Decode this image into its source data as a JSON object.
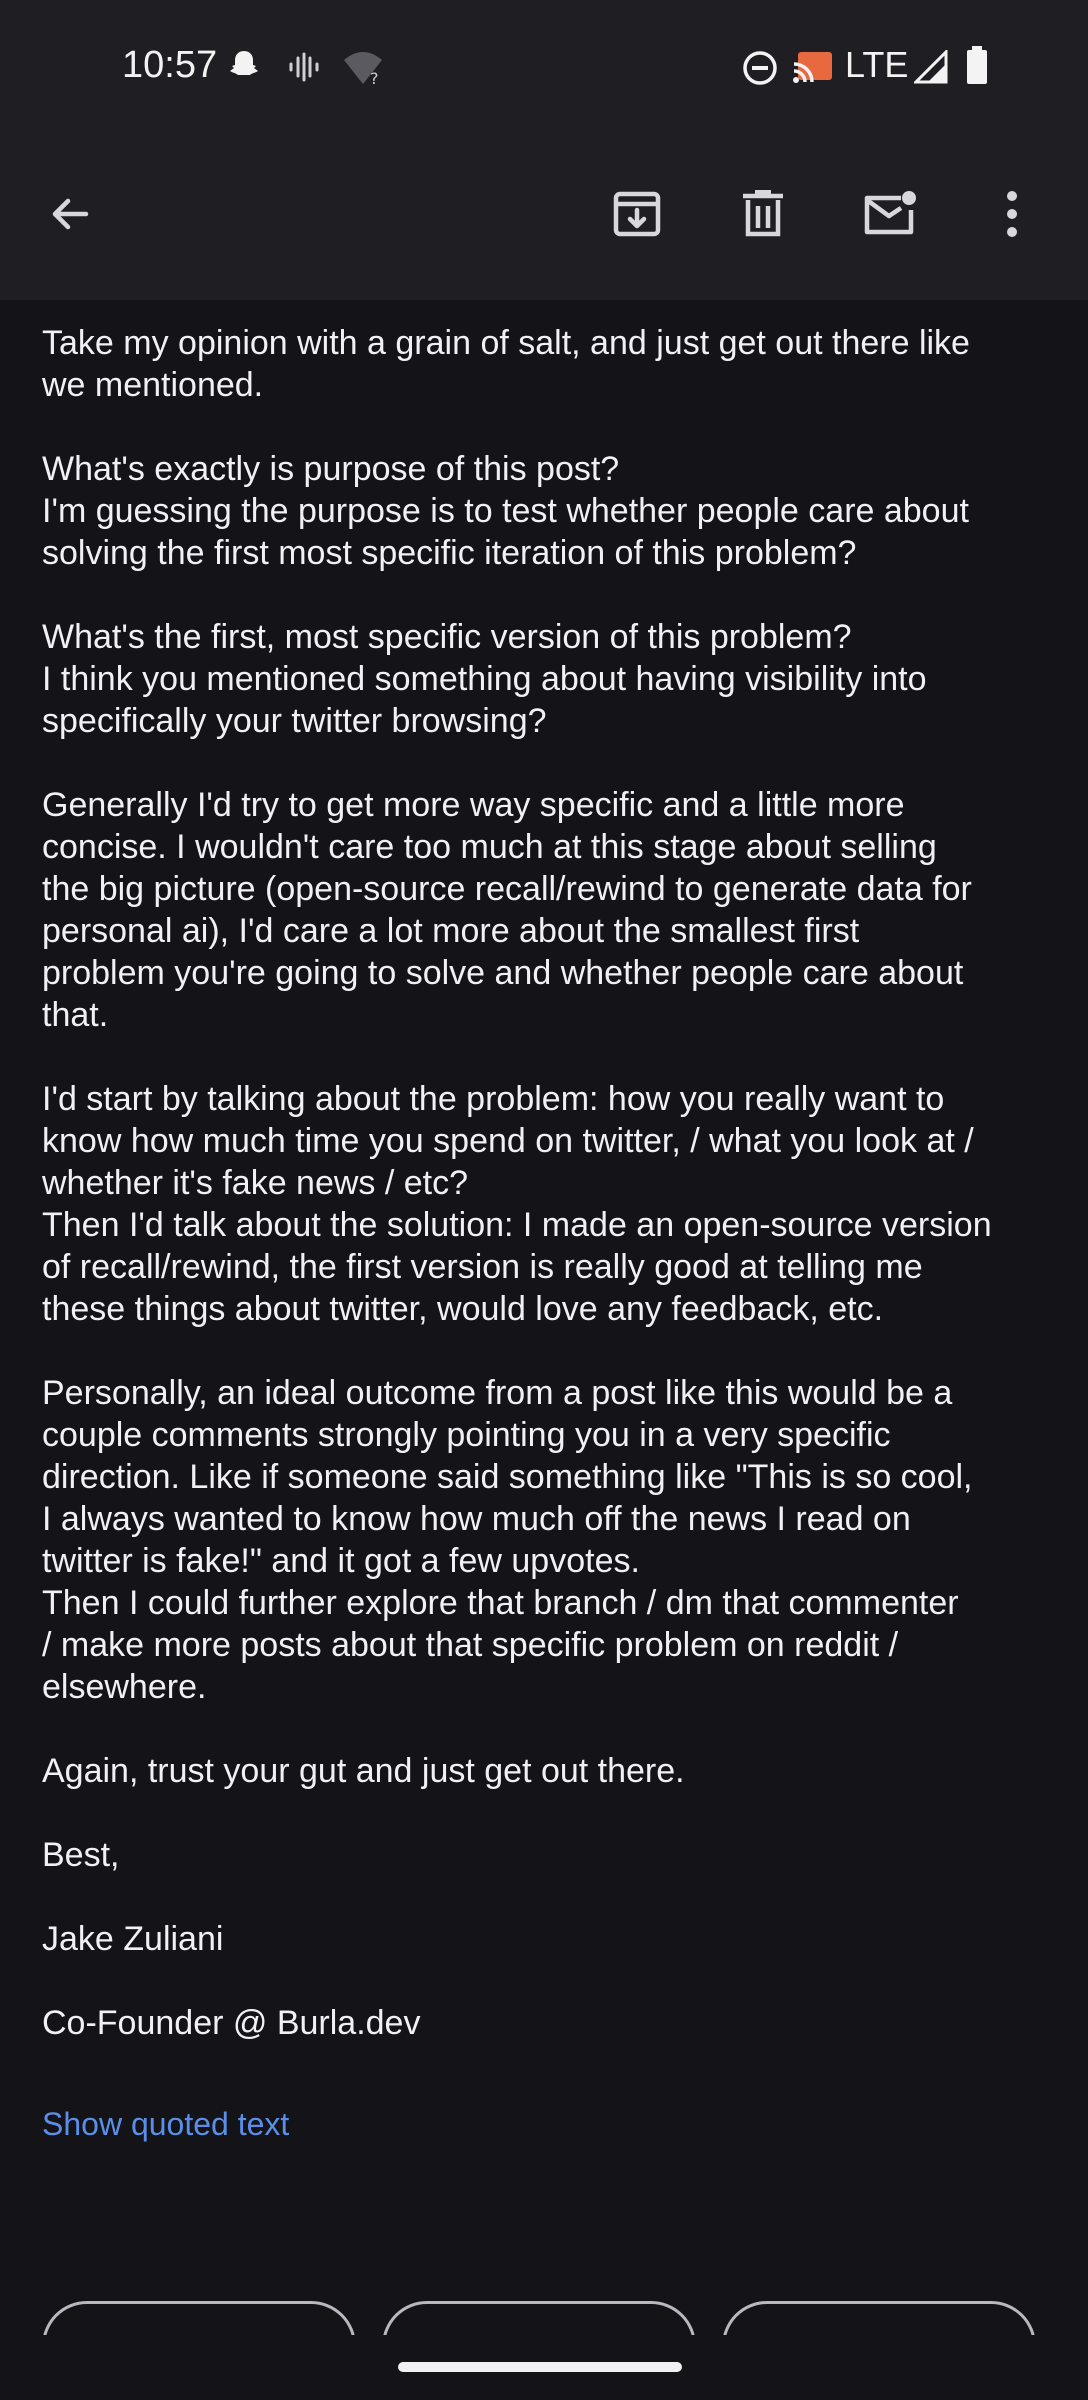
{
  "status_bar": {
    "time": "10:57",
    "network": "LTE",
    "icons": [
      "snapchat-icon",
      "voicemail-icon",
      "wifi-unknown-icon",
      "dnd-icon",
      "cast-icon",
      "signal-icon",
      "battery-icon"
    ]
  },
  "toolbar": {
    "back_icon": "arrow-back-icon",
    "actions": [
      "archive-icon",
      "delete-icon",
      "mark-unread-icon",
      "more-options-icon"
    ]
  },
  "email": {
    "paragraphs": [
      [
        "Take my opinion with a grain of salt, and just get out there like",
        "we mentioned."
      ],
      [
        "What's exactly is purpose of this post?",
        "I'm guessing the purpose is to test whether people care about",
        "solving the first most specific iteration of this problem?"
      ],
      [
        "What's the first, most specific version of this problem?",
        "I think you mentioned something about having visibility into",
        "specifically your twitter browsing?"
      ],
      [
        "Generally I'd try to get more way specific and a little more",
        "concise. I wouldn't care too much at this stage about selling",
        "the big picture (open-source recall/rewind to generate data for",
        "personal ai), I'd care a lot more about the smallest first",
        "problem you're going to solve and whether people care about",
        "that."
      ],
      [
        "I'd start by talking about the problem: how you really want to",
        "know how much time you spend on twitter, / what you look at /",
        "whether it's fake news / etc?",
        "Then I'd talk about the solution: I made an open-source version",
        "of recall/rewind, the first version is really good at telling me",
        "these things about twitter, would love any feedback, etc."
      ],
      [
        "Personally, an ideal outcome from a post like this would be a",
        "couple comments strongly pointing you in a very specific",
        "direction. Like if someone said something like \"This is so cool,",
        "I always wanted to know how much off the news I read on",
        "twitter is fake!\" and it got a few upvotes.",
        "Then I could further explore that branch / dm that commenter",
        "/ make more posts about that specific problem on reddit /",
        "elsewhere."
      ],
      [
        "Again, trust your gut and just get out there."
      ],
      [
        "Best,"
      ]
    ],
    "signature_name": "Jake Zuliani",
    "signature_title": "Co-Founder @ Burla.dev",
    "show_quoted_text": "Show quoted text"
  },
  "smart_replies": [
    "",
    "",
    ""
  ],
  "colors": {
    "background": "#131318",
    "toolbar": "#1f1f23",
    "link": "#5a8ee8"
  }
}
